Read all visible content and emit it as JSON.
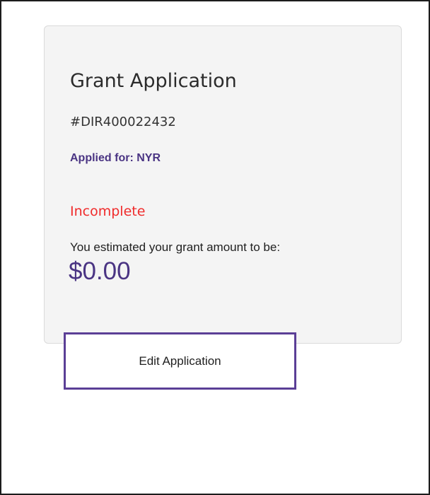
{
  "card": {
    "title": "Grant Application",
    "application_id": "#DIR400022432",
    "applied_for": "Applied for: NYR",
    "status": "Incomplete",
    "estimate_label": "You estimated your grant amount to be:",
    "estimate_amount": "$0.00",
    "edit_button_label": "Edit Application"
  },
  "colors": {
    "accent_purple": "#4a3483",
    "button_border": "#5b3f96",
    "status_red": "#f02b2b",
    "card_background": "#f4f4f4"
  }
}
